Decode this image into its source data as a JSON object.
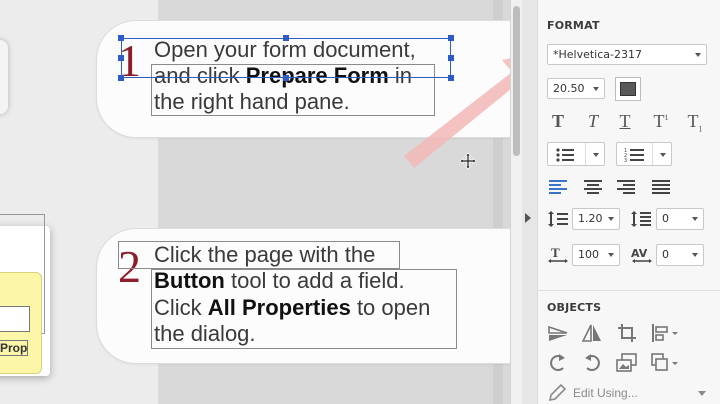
{
  "step1": {
    "number": "1",
    "line1": "Open your form document,",
    "line2_pre": "and click ",
    "line2_bold": "Prepare Form",
    "line2_post": " in",
    "line3": "the right hand pane."
  },
  "step2": {
    "number": "2",
    "line1": "Click the page with the",
    "line2_bold": "Button",
    "line2_post": " tool to add a field.",
    "line3_pre": "Click ",
    "line3_bold": "All Properties",
    "line3_post": " to open",
    "line4": "the dialog."
  },
  "partial_button_label": "Properties",
  "panel": {
    "format_title": "FORMAT",
    "font_name": "*Helvetica-2317",
    "font_size": "20.50",
    "text_color": "#595959",
    "style_buttons": [
      "T",
      "T",
      "T",
      "T",
      "T"
    ],
    "line_spacing": "1.20",
    "paragraph_spacing": "0",
    "horizontal_scale": "100",
    "char_spacing": "0",
    "objects_title": "OBJECTS",
    "edit_using": "Edit Using..."
  },
  "colors": {
    "accent_blue": "#3a74c8",
    "step_number": "#8d1d2b",
    "arrow_pink": "#f3b7b7"
  }
}
